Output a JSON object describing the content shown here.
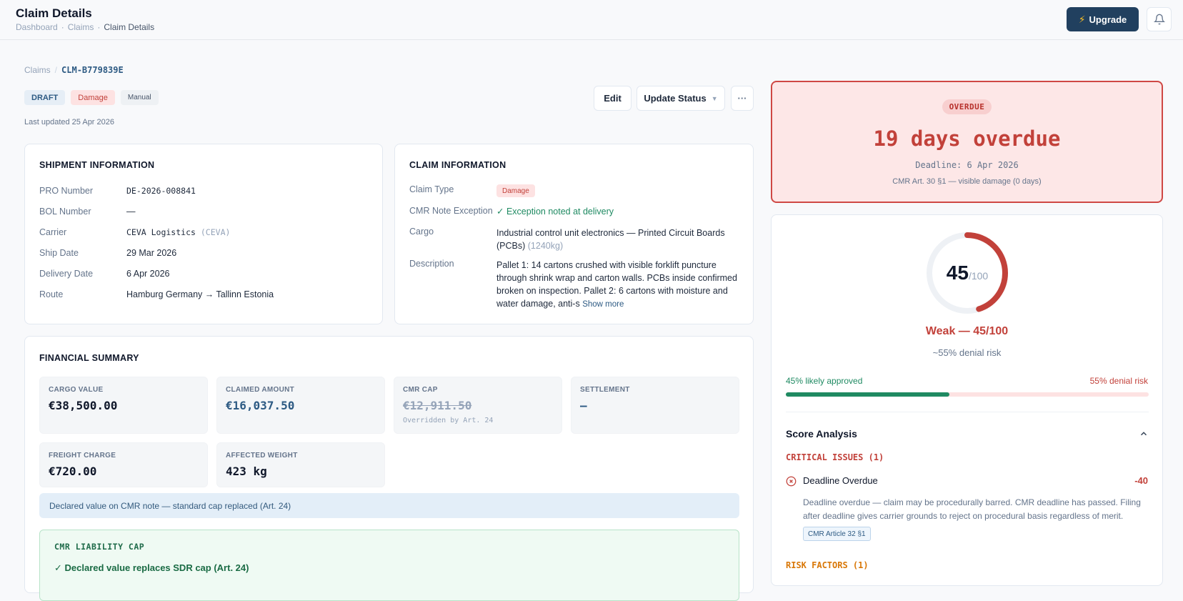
{
  "header": {
    "title": "Claim Details",
    "crumbs": [
      "Dashboard",
      "Claims",
      "Claim Details"
    ],
    "upgrade_label": "Upgrade",
    "upgrade_icon": "bolt-icon",
    "bell_icon": "bell-icon"
  },
  "claim": {
    "crumb_parent": "Claims",
    "id": "CLM-B779839E",
    "badges": [
      "DRAFT",
      "Damage",
      "Manual"
    ],
    "updated": "Last updated 25 Apr 2026"
  },
  "actions": {
    "edit": "Edit",
    "update_status": "Update Status",
    "more_icon": "ellipsis-icon"
  },
  "shipment": {
    "title": "SHIPMENT INFORMATION",
    "rows": [
      {
        "k": "PRO Number",
        "v": "DE-2026-008841"
      },
      {
        "k": "BOL Number",
        "v": "—"
      },
      {
        "k": "Carrier",
        "v": "CEVA Logistics",
        "extra": "(CEVA)"
      },
      {
        "k": "Ship Date",
        "v": "29 Mar 2026"
      },
      {
        "k": "Delivery Date",
        "v": "6 Apr 2026"
      },
      {
        "k": "Route",
        "v": "Hamburg Germany → Tallinn Estonia"
      }
    ]
  },
  "claim_info": {
    "title": "CLAIM INFORMATION",
    "type_label": "Claim Type",
    "type_value": "Damage",
    "cmr_label": "CMR Note Exception",
    "cmr_value": "✓ Exception noted at delivery",
    "cargo_label": "Cargo",
    "cargo_value": "Industrial control unit electronics — Printed Circuit Boards",
    "cargo_value2": "(PCBs)",
    "cargo_weight": "(1240kg)",
    "desc_label": "Description",
    "desc_lines": [
      "Pallet 1: 14 cartons crushed with visible forklift puncture",
      "through shrink wrap and carton walls. PCBs inside confirmed",
      "broken on inspection. Pallet 2: 6 cartons with moisture and",
      "water damage, anti-s"
    ],
    "show_more": "Show more"
  },
  "financial": {
    "title": "FINANCIAL SUMMARY",
    "cargo_value_label": "CARGO VALUE",
    "cargo_value": "€38,500.00",
    "claimed_label": "CLAIMED AMOUNT",
    "claimed": "€16,037.50",
    "cap_label": "CMR CAP",
    "cap": "€12,911.50",
    "cap_note": "Overridden by Art. 24",
    "settlement_label": "SETTLEMENT",
    "settlement": "—",
    "freight_label": "FREIGHT CHARGE",
    "freight": "€720.00",
    "weight_label": "AFFECTED WEIGHT",
    "weight": "423 kg",
    "notice": "Declared value on CMR note — standard cap replaced (Art. 24)",
    "liability_title": "CMR LIABILITY CAP",
    "liability_text": "✓ Declared value replaces SDR cap (Art. 24)"
  },
  "deadline": {
    "badge": "OVERDUE",
    "headline": "19 days overdue",
    "deadline": "Deadline: 6 Apr 2026",
    "basis": "CMR Art. 30 §1 — visible damage (0 days)"
  },
  "score": {
    "value": "45",
    "max": "/100",
    "fraction": 0.45,
    "verdict": "Weak — 45/100",
    "risk": "~55% denial risk",
    "approve_label": "45% likely approved",
    "deny_label": "55% denial risk",
    "approve_fraction": 0.45,
    "analysis_title": "Score Analysis",
    "critical_title": "CRITICAL ISSUES (1)",
    "issue_title": "Deadline Overdue",
    "issue_points": "-40",
    "issue_lines": [
      "Deadline overdue — claim may be procedurally barred. CMR deadline has passed. Filing",
      "after deadline gives carrier grounds to reject on procedural basis regardless of merit."
    ],
    "issue_ref": "CMR Article 32 §1",
    "risk_title": "RISK FACTORS (1)"
  },
  "colors": {
    "navy": "#21405f",
    "red": "#c2413a",
    "green": "#1f8a62",
    "blue": "#2d5a83"
  }
}
